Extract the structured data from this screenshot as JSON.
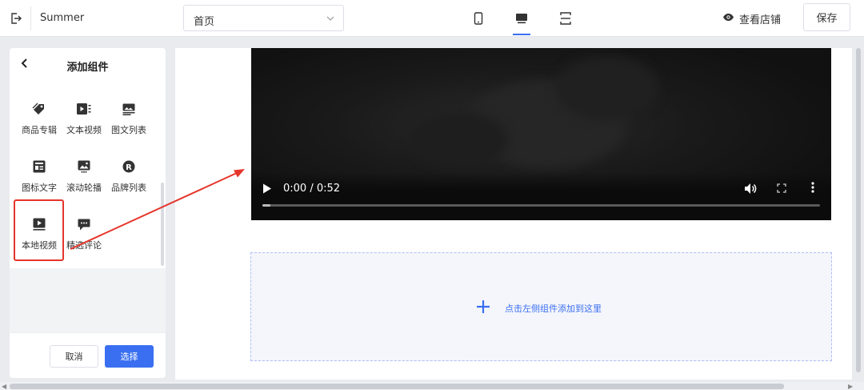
{
  "header": {
    "app_title": "Summer",
    "page_select_value": "首页",
    "view_store_label": "查看店铺",
    "save_label": "保存",
    "accent_color": "#3a6ff2",
    "devices": [
      "mobile-icon",
      "desktop-icon",
      "fit-screen-icon"
    ],
    "active_device": "desktop-icon"
  },
  "panel": {
    "title": "添加组件",
    "components": [
      {
        "label": "商品专辑",
        "icon": "tag-icon"
      },
      {
        "label": "文本视频",
        "icon": "text-video-icon"
      },
      {
        "label": "图文列表",
        "icon": "image-list-icon"
      },
      {
        "label": "图标文字",
        "icon": "icon-text-icon"
      },
      {
        "label": "滚动轮播",
        "icon": "carousel-icon"
      },
      {
        "label": "品牌列表",
        "icon": "brand-icon"
      },
      {
        "label": "本地视频",
        "icon": "local-video-icon"
      },
      {
        "label": "精选评论",
        "icon": "comment-icon"
      }
    ],
    "selected": "本地视频",
    "cancel_label": "取消",
    "select_label": "选择"
  },
  "canvas": {
    "video": {
      "time": "0:00 / 0:52",
      "progress_fraction": 0.0
    },
    "dropzone_text": "点击左侧组件添加到这里"
  },
  "annotation": {
    "highlight_color": "#e5352b"
  }
}
